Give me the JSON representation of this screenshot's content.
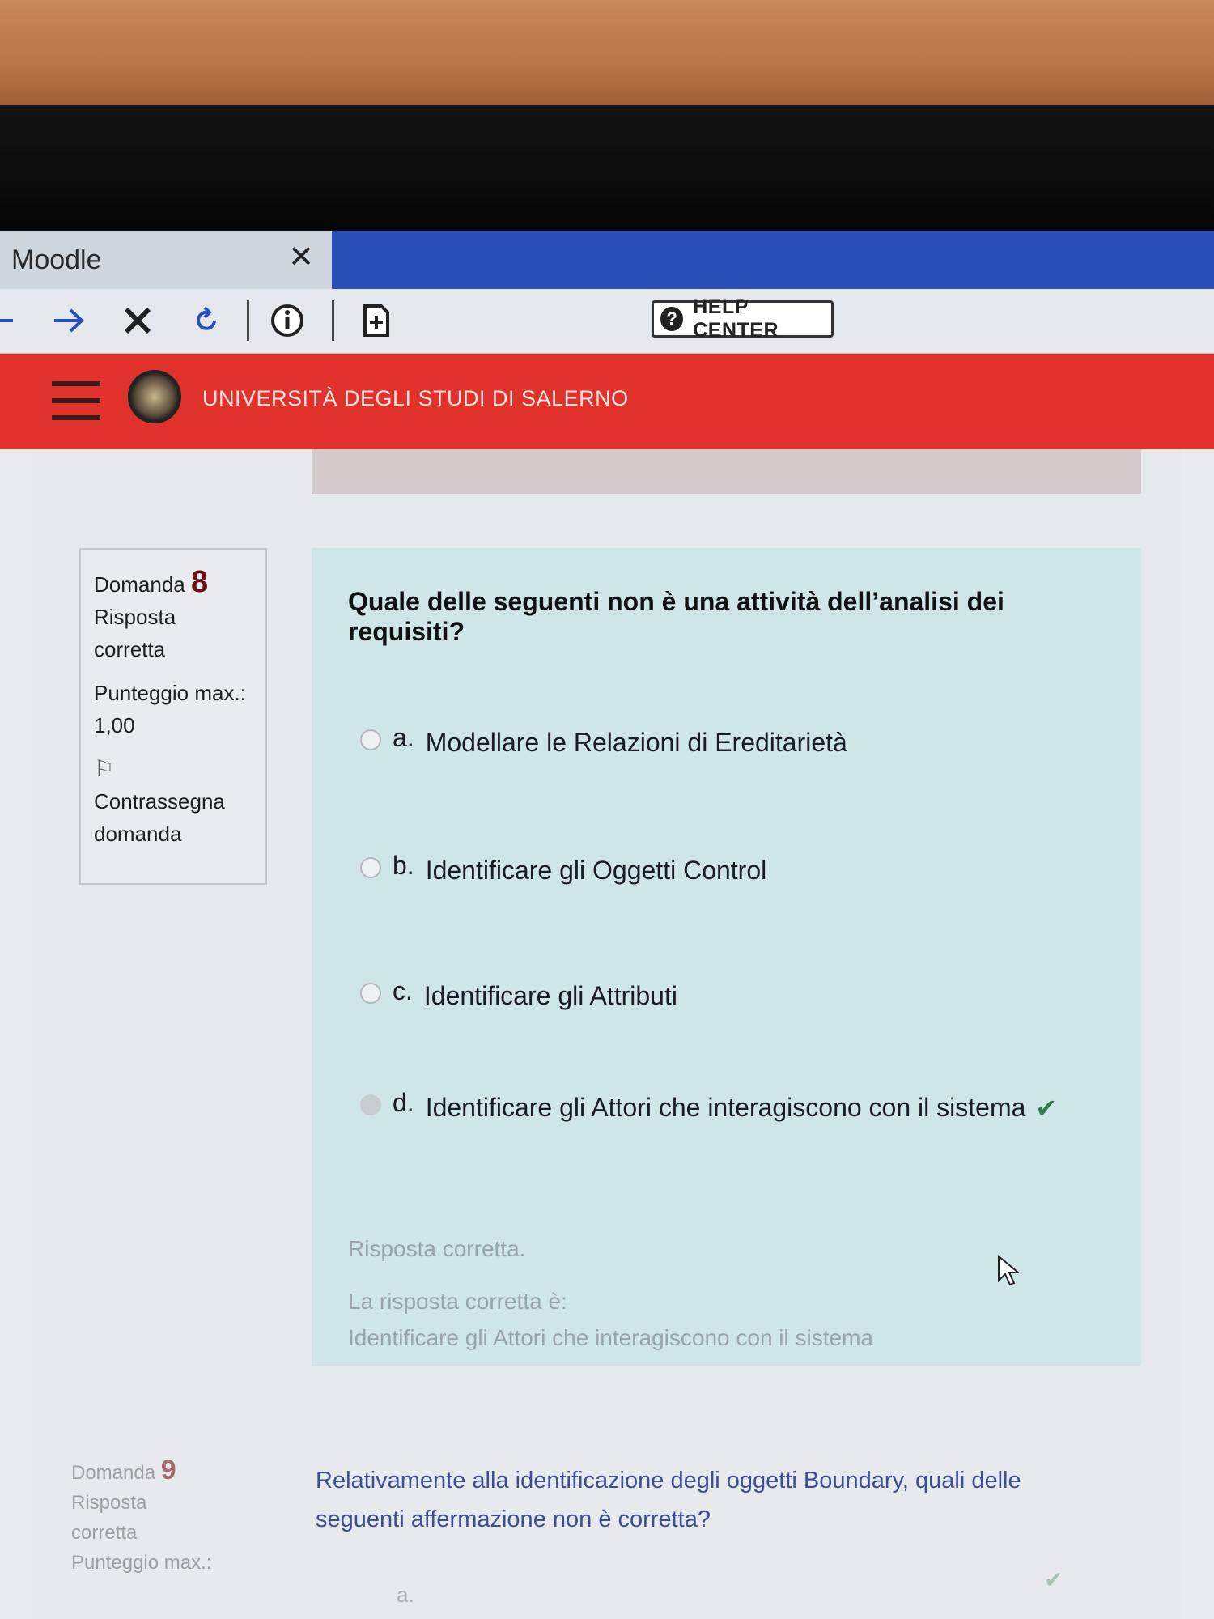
{
  "browser": {
    "tab_title": "Moodle",
    "tab_close": "✕",
    "help_label": "HELP CENTER",
    "help_glyph": "?"
  },
  "header": {
    "university": "UNIVERSITÀ DEGLI STUDI DI SALERNO",
    "color": "#e0322a"
  },
  "question8": {
    "label": "Domanda",
    "number": "8",
    "status_line1": "Risposta",
    "status_line2": "corretta",
    "score_line1": "Punteggio max.:",
    "score_line2": "1,00",
    "flag_line1": "Contrassegna",
    "flag_line2": "domanda",
    "text": "Quale delle seguenti non è una attività dell’analisi dei requisiti?",
    "options": [
      {
        "letter": "a.",
        "text": "Modellare le Relazioni di Ereditarietà"
      },
      {
        "letter": "b.",
        "text": "Identificare gli Oggetti Control"
      },
      {
        "letter": "c.",
        "text": "Identificare gli Attributi"
      },
      {
        "letter": "d.",
        "text": "Identificare gli Attori che interagiscono con il sistema"
      }
    ],
    "selected_option": "d.",
    "feedback_status": "Risposta corretta.",
    "feedback_intro": "La risposta corretta è:",
    "feedback_answer": "Identificare gli Attori che interagiscono con il sistema"
  },
  "question9": {
    "label": "Domanda",
    "number": "9",
    "status_line1": "Risposta",
    "status_line2": "corretta",
    "score_line1": "Punteggio max.:",
    "text": "Relativamente alla identificazione degli oggetti Boundary, quali delle seguenti affermazione non è corretta?",
    "first_option_letter": "a."
  }
}
